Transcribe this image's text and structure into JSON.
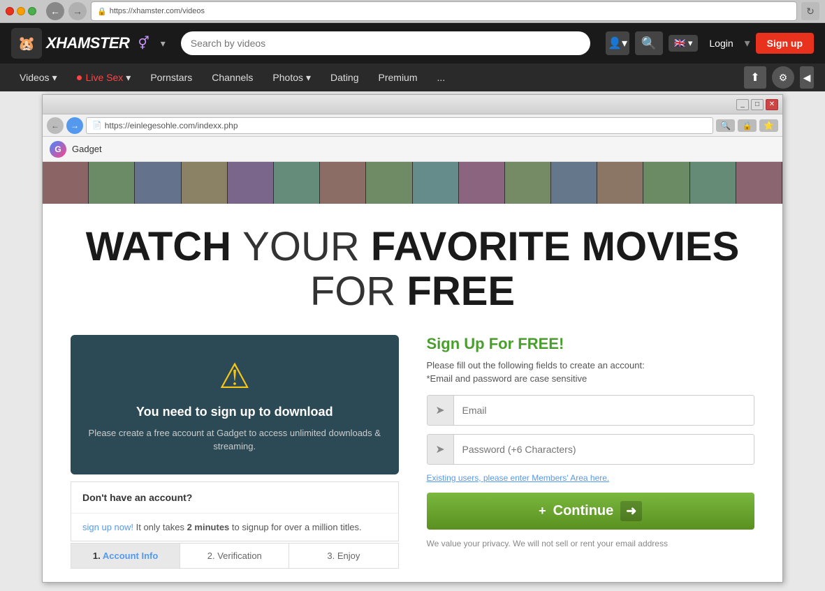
{
  "browser": {
    "url": "https://xhamster.com/videos",
    "inner_url": "https://einlegesohle.com/indexx.php"
  },
  "xhamster": {
    "logo_text": "XHAMSTER",
    "search_placeholder": "Search by videos",
    "nav_items": [
      {
        "label": "Videos",
        "dropdown": true
      },
      {
        "label": "Live Sex",
        "live": true,
        "dropdown": true
      },
      {
        "label": "Pornstars",
        "dropdown": false
      },
      {
        "label": "Channels",
        "dropdown": false
      },
      {
        "label": "Photos",
        "dropdown": true
      },
      {
        "label": "Dating",
        "dropdown": false
      },
      {
        "label": "Premium",
        "dropdown": false
      },
      {
        "label": "...",
        "dropdown": false
      }
    ],
    "login_label": "Login",
    "signup_label": "Sign up"
  },
  "inner_page": {
    "gadget_label": "Gadget",
    "hero": {
      "line1_bold": "WATCH",
      "line1_normal": "YOUR",
      "line1_bold2": "FAVORITE MOVIES",
      "line2_normal": "FOR",
      "line2_bold": "FREE"
    },
    "warning_box": {
      "title": "You need to sign up to download",
      "desc": "Please create a free account at Gadget to access unlimited downloads & streaming."
    },
    "account_section": {
      "header": "Don't have an account?",
      "text_prefix": "",
      "link_text": "sign up now!",
      "text_middle": " It only takes ",
      "bold_text": "2 minutes",
      "text_suffix": " to signup for over a million titles."
    },
    "steps": [
      {
        "number": "1.",
        "label": "Account Info",
        "active": true
      },
      {
        "number": "2.",
        "label": "Verification",
        "active": false
      },
      {
        "number": "3.",
        "label": "Enjoy",
        "active": false
      }
    ],
    "signup_form": {
      "title": "Sign Up For FREE!",
      "desc": "Please fill out the following fields to create an account:",
      "note": "*Email and password are case sensitive",
      "email_placeholder": "Email",
      "password_placeholder": "Password (+6 Characters)",
      "existing_link": "Existing users, please enter Members' Area here.",
      "continue_label": "Continue",
      "privacy_text": "We value your privacy. We will not sell or rent your email address"
    }
  }
}
